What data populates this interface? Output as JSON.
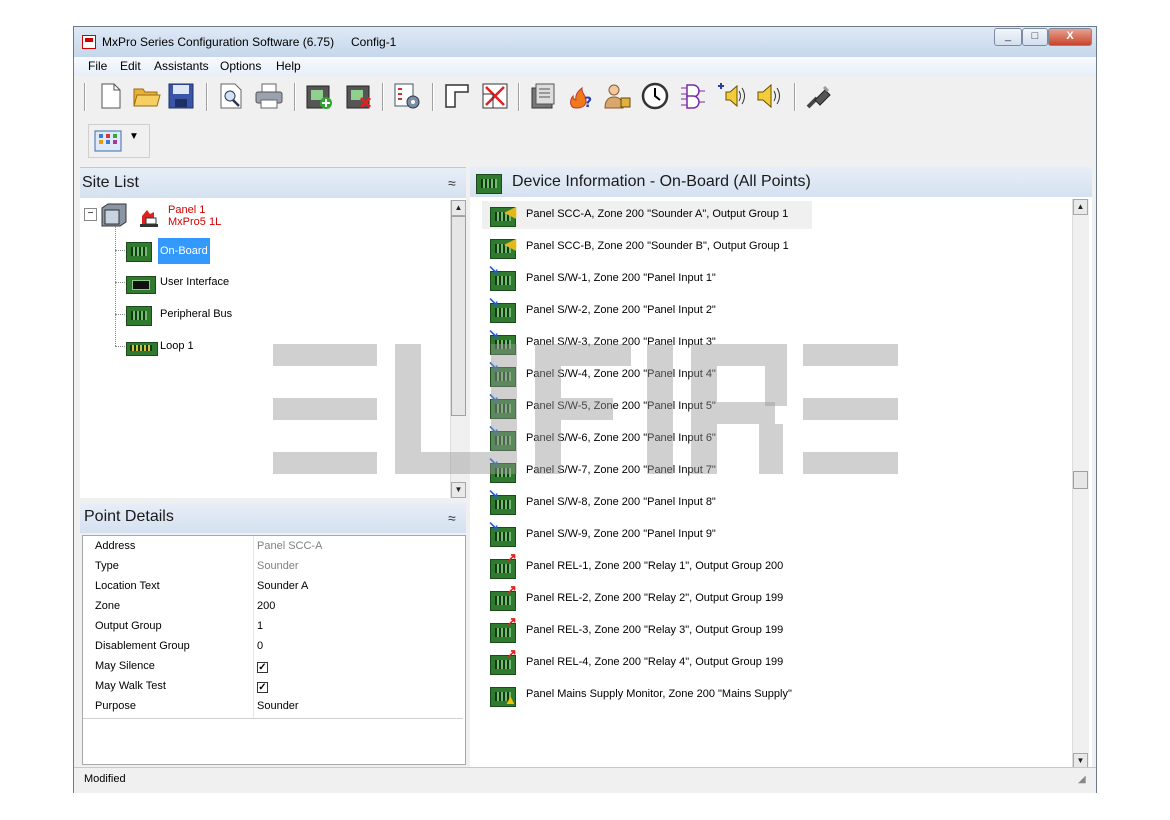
{
  "window": {
    "title": "MxPro Series Configuration Software  (6.75)",
    "config_name": "Config-1",
    "minimize": "_",
    "maximize": "□",
    "close": "X"
  },
  "menu": [
    "File",
    "Edit",
    "Assistants",
    "Options",
    "Help"
  ],
  "toolbar": {
    "icons": [
      "new-file-icon",
      "open-folder-icon",
      "save-icon",
      "print-preview-icon",
      "print-icon",
      "add-device-icon",
      "delete-device-icon",
      "configure-icon",
      "layout-icon",
      "cancel-layout-icon",
      "panel-info-icon",
      "fire-query-icon",
      "user-access-icon",
      "clock-icon",
      "logic-gate-icon",
      "sounder-add-icon",
      "sounder-icon",
      "usb-connect-icon"
    ]
  },
  "site_list": {
    "header": "Site List",
    "panel_label_line1": "Panel 1",
    "panel_label_line2": "MxPro5 1L",
    "items": [
      {
        "label": "On-Board",
        "selected": true
      },
      {
        "label": "User Interface",
        "selected": false
      },
      {
        "label": "Peripheral Bus",
        "selected": false
      },
      {
        "label": "Loop 1",
        "selected": false
      }
    ]
  },
  "point_details": {
    "header": "Point Details",
    "rows": [
      {
        "label": "Address",
        "value": "Panel SCC-A",
        "kind": "grey"
      },
      {
        "label": "Type",
        "value": "Sounder",
        "kind": "grey"
      },
      {
        "label": "Location Text",
        "value": "Sounder A",
        "kind": "text"
      },
      {
        "label": "Zone",
        "value": "200",
        "kind": "text"
      },
      {
        "label": "Output Group",
        "value": "1",
        "kind": "text"
      },
      {
        "label": "Disablement Group",
        "value": "0",
        "kind": "text"
      },
      {
        "label": "May Silence",
        "value": "",
        "kind": "check",
        "checked": true
      },
      {
        "label": "May Walk Test",
        "value": "",
        "kind": "check",
        "checked": true
      },
      {
        "label": "Purpose",
        "value": "Sounder",
        "kind": "text"
      }
    ]
  },
  "device_info": {
    "header": "Device Information - On-Board  (All Points)",
    "rows": [
      {
        "text": "Panel SCC-A, Zone 200 \"Sounder A\",  Output Group 1",
        "icon": "sounder",
        "selected": true
      },
      {
        "text": "Panel SCC-B, Zone 200 \"Sounder B\",  Output Group 1",
        "icon": "sounder"
      },
      {
        "text": "Panel S/W-1, Zone 200 \"Panel Input 1\"",
        "icon": "input"
      },
      {
        "text": "Panel S/W-2, Zone 200 \"Panel Input 2\"",
        "icon": "input"
      },
      {
        "text": "Panel S/W-3, Zone 200 \"Panel Input 3\"",
        "icon": "input"
      },
      {
        "text": "Panel S/W-4, Zone 200 \"Panel Input 4\"",
        "icon": "input"
      },
      {
        "text": "Panel S/W-5, Zone 200 \"Panel Input 5\"",
        "icon": "input"
      },
      {
        "text": "Panel S/W-6, Zone 200 \"Panel Input 6\"",
        "icon": "input"
      },
      {
        "text": "Panel S/W-7, Zone 200 \"Panel Input 7\"",
        "icon": "input"
      },
      {
        "text": "Panel S/W-8, Zone 200 \"Panel Input 8\"",
        "icon": "input"
      },
      {
        "text": "Panel S/W-9, Zone 200 \"Panel Input 9\"",
        "icon": "input"
      },
      {
        "text": "Panel REL-1, Zone 200 \"Relay 1\",  Output Group 200",
        "icon": "relay"
      },
      {
        "text": "Panel REL-2, Zone 200 \"Relay 2\",  Output Group 199",
        "icon": "relay"
      },
      {
        "text": "Panel REL-3, Zone 200 \"Relay 3\",  Output Group 199",
        "icon": "relay"
      },
      {
        "text": "Panel REL-4, Zone 200 \"Relay 4\",  Output Group 199",
        "icon": "relay"
      },
      {
        "text": "Panel Mains Supply Monitor, Zone 200 \"Mains Supply\"",
        "icon": "warning"
      }
    ]
  },
  "status": "Modified",
  "colors": {
    "selection": "#3399ff",
    "panel_label": "#d40000",
    "header_bg": "#dbe5f1"
  }
}
